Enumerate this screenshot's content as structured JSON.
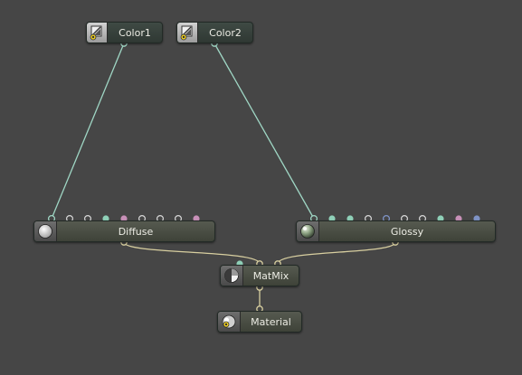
{
  "node_editor": {
    "nodes": {
      "color1": {
        "label": "Color1",
        "icon": "rgb-texture-icon"
      },
      "color2": {
        "label": "Color2",
        "icon": "rgb-texture-icon"
      },
      "diffuse": {
        "label": "Diffuse",
        "icon": "diffuse-material-icon"
      },
      "glossy": {
        "label": "Glossy",
        "icon": "glossy-material-icon"
      },
      "matmix": {
        "label": "MatMix",
        "icon": "mix-material-icon"
      },
      "material": {
        "label": "Material",
        "icon": "material-output-icon"
      }
    },
    "colors": {
      "background": "#464646",
      "texture_wire": "#9fd6c4",
      "material_wire": "#d8cfa0",
      "pin_teal": "#8fd0b8",
      "pin_pink": "#c890b8",
      "pin_blue": "#7f93c6",
      "pin_empty_fill": "#464646"
    },
    "diffuse_input_pins": [
      "teal-empty",
      "empty",
      "empty",
      "teal",
      "pink",
      "empty",
      "empty",
      "empty",
      "pink"
    ],
    "glossy_input_pins": [
      "teal-empty",
      "teal",
      "teal",
      "empty",
      "blue-empty",
      "empty",
      "empty",
      "teal",
      "pink",
      "blue"
    ]
  }
}
